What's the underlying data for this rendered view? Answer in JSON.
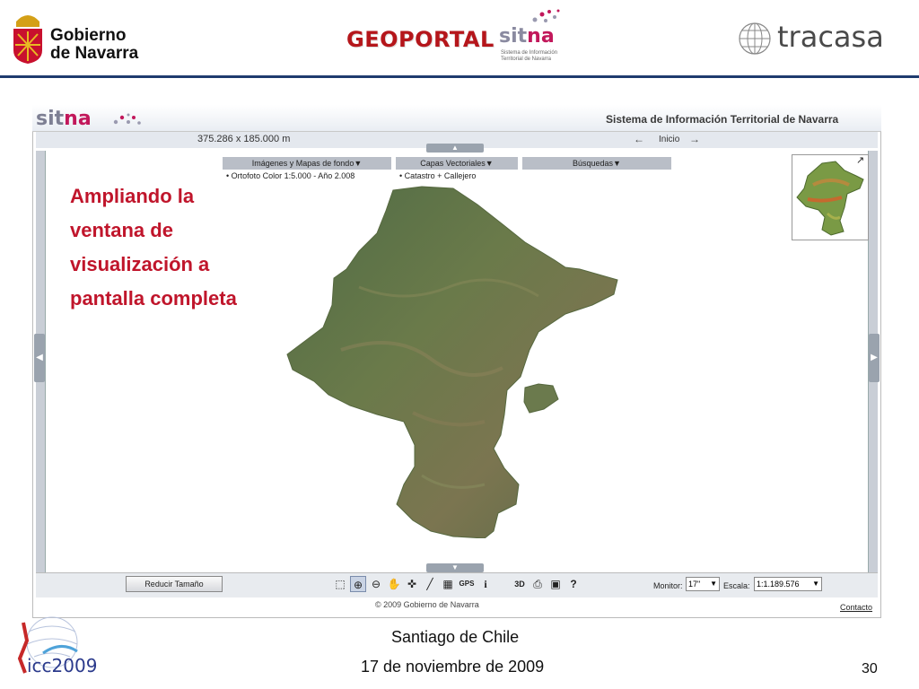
{
  "header": {
    "gobierno_line1": "Gobierno",
    "gobierno_line2": "de Navarra",
    "geoportal": "GEOPORTAL",
    "sitna_s": "sit",
    "sitna_n": "na",
    "sitna_sub1": "Sistema de Información",
    "sitna_sub2": "Territorial de Navarra",
    "tracasa": "tracasa"
  },
  "app": {
    "logo_s": "sit",
    "logo_n": "na",
    "title": "Sistema de Información Territorial de Navarra",
    "scale_text": "375.286 x 185.000 m",
    "nav_left_icon": "arrow-left-icon",
    "inicio": "Inicio",
    "nav_right_icon": "arrow-right-icon",
    "menus": {
      "imagenes": "Imágenes y Mapas de fondo▼",
      "capas": "Capas Vectoriales▼",
      "busquedas": "Búsquedas▼"
    },
    "submenus": {
      "orto": "• Ortofoto Color 1:5.000 - Año 2.008",
      "catastro": "• Catastro + Callejero"
    },
    "overlay_text": [
      "Ampliando la",
      "ventana de",
      "visualización a",
      "pantalla completa"
    ],
    "toolbar": {
      "reducir": "Reducir Tamaño",
      "tools": [
        "crop-icon",
        "zoom-in-icon",
        "zoom-out-icon",
        "pan-hand-icon",
        "navigate-icon",
        "measure-icon",
        "grid-icon",
        "GPS",
        "info-icon",
        "3D",
        "print-icon",
        "camera-icon",
        "help-icon"
      ],
      "gps": "GPS",
      "three_d": "3D",
      "info": "i",
      "help": "?",
      "monitor_label": "Monitor:",
      "monitor_value": "17\"",
      "escala_label": "Escala:",
      "escala_value": "1:1.189.576"
    },
    "copyright": "© 2009 Gobierno de Navarra",
    "contacto": "Contacto"
  },
  "footer": {
    "icc": "icc2009",
    "line1": "Santiago de Chile",
    "line2": "17 de noviembre de 2009",
    "page": "30"
  },
  "colors": {
    "accent_red": "#c0152b",
    "header_line": "#1f3b6e",
    "sitna_pink": "#c2185b"
  }
}
